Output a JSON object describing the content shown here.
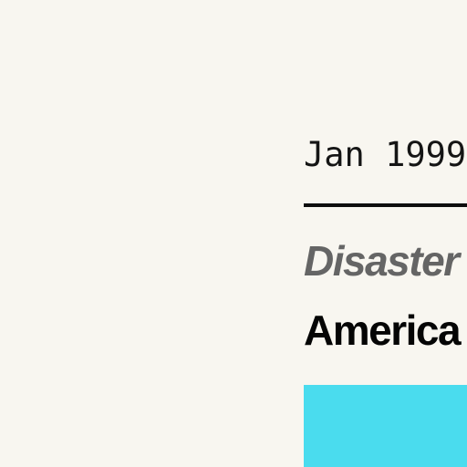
{
  "card": {
    "date": "Jan 1999",
    "category": "Disaster",
    "title": "America"
  },
  "colors": {
    "background": "#f8f6f0",
    "rule": "#0e0e0e",
    "category_text": "#656565",
    "title_text": "#050505",
    "swatch": "#4adcee"
  }
}
